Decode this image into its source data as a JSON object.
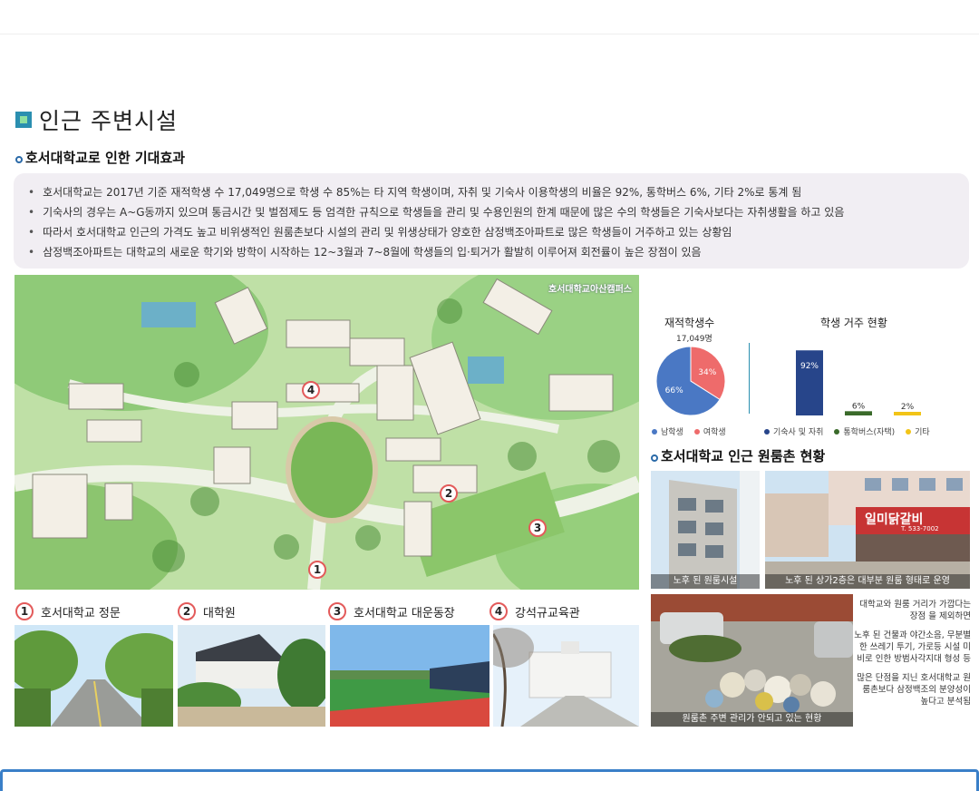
{
  "page": {
    "section_title": "인근 주변시설",
    "subsection_effects": "호서대학교로 인한 기대효과",
    "bullets": [
      "호서대학교는 2017년 기준 재적학생 수 17,049명으로 학생 수 85%는 타 지역 학생이며, 자취 및 기숙사 이용학생의 비율은 92%, 통학버스 6%, 기타 2%로 통계 됨",
      "기숙사의 경우는 A~G동까지 있으며 통금시간 및 벌점제도 등 엄격한 규칙으로 학생들을 관리 및 수용인원의 한계 때문에 많은 수의 학생들은 기숙사보다는 자취생활을 하고 있음",
      "따라서 호서대학교 인근의 가격도 높고 비위생적인 원룸촌보다 시설의 관리 및 위생상태가 양호한 삼정백조아파트로 많은 학생들이 거주하고 있는 상황임",
      "삼정백조아파트는 대학교의 새로운 학기와 방학이 시작하는 12~3월과 7~8월에 학생들의 입·퇴거가 활발히 이루어져 회전률이 높은 장점이 있음"
    ],
    "map_label": "호서대학교아산캠퍼스",
    "markers": [
      "1",
      "2",
      "3",
      "4"
    ],
    "places": [
      {
        "num": "1",
        "name": "호서대학교 정문"
      },
      {
        "num": "2",
        "name": "대학원"
      },
      {
        "num": "3",
        "name": "호서대학교 대운동장"
      },
      {
        "num": "4",
        "name": "강석규교육관"
      }
    ],
    "subsection_rooms": "호서대학교 인근 원룸촌 현황",
    "room_photos": [
      "노후 된 원룸시설",
      "노후 된 상가2층은 대부분 원룸 형태로 운영",
      "원룸촌 주변 관리가 안되고 있는 현황"
    ],
    "shop_sign": "일미닭갈비",
    "shop_phone": "T. 533-7002",
    "side_paragraphs": [
      "대학교와 원룸 거리가 가깝다는장점 을 제외하면",
      "노후 된 건물과 야간소음, 무분별한 쓰레기 투기, 가로등 시설 미비로 인한 방범사각지대 형성 등",
      "많은 단점을 지닌 호서대학교 원룸촌보다 삼정백조의 분양성이 높다고 분석됨"
    ]
  },
  "chart_data": [
    {
      "type": "pie",
      "title": "재적학생수",
      "subtitle": "17,049명",
      "slices": [
        {
          "name": "남학생",
          "value": 66,
          "label": "66%",
          "color": "#4a78c4"
        },
        {
          "name": "여학생",
          "value": 34,
          "label": "34%",
          "color": "#ee6b6b"
        }
      ]
    },
    {
      "type": "bar",
      "title": "학생 거주 현황",
      "categories": [
        "기숙사 및 자취",
        "통학버스(자택)",
        "기타"
      ],
      "values": [
        92,
        6,
        2
      ],
      "labels": [
        "92%",
        "6%",
        "2%"
      ],
      "colors": [
        "#27458a",
        "#3a6a2a",
        "#f2c417"
      ],
      "ylim": [
        0,
        100
      ]
    }
  ]
}
